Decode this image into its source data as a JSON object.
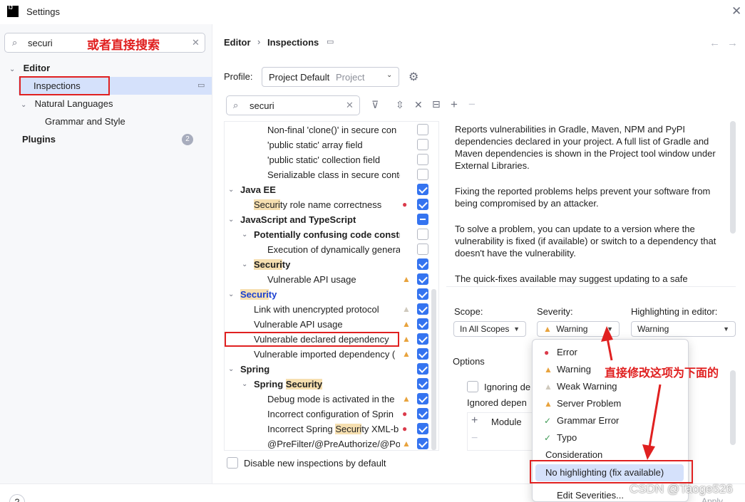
{
  "window": {
    "title": "Settings",
    "app_icon_text": "IJ"
  },
  "left": {
    "search_value": "securi",
    "annotation": "或者直接搜索",
    "tree": [
      {
        "label": "Editor"
      },
      {
        "label": "Inspections"
      },
      {
        "label": "Natural Languages"
      },
      {
        "label": "Grammar and Style"
      },
      {
        "label": "Plugins",
        "badge": "2"
      }
    ]
  },
  "header": {
    "breadcrumb_parent": "Editor",
    "breadcrumb_current": "Inspections",
    "back": "←",
    "forward": "→"
  },
  "profile": {
    "label": "Profile:",
    "value": "Project Default",
    "suffix": "Project"
  },
  "filter": {
    "search_value": "securi"
  },
  "inspections": [
    {
      "text": "Non-final 'clone()' in secure con",
      "checked": "off",
      "indent": 3
    },
    {
      "text": "'public static' array field",
      "checked": "off",
      "indent": 3
    },
    {
      "text": "'public static' collection field",
      "checked": "off",
      "indent": 3
    },
    {
      "text": "Serializable class in secure conte",
      "checked": "off",
      "indent": 3
    },
    {
      "text": "Java EE",
      "checked": "on",
      "indent": 1,
      "group": true
    },
    {
      "pre": "",
      "hl": "Securi",
      "post": "ty role name correctness",
      "checked": "on",
      "indent": 2,
      "sev": "err"
    },
    {
      "text": "JavaScript and TypeScript",
      "checked": "mixed",
      "indent": 1,
      "group": true
    },
    {
      "text": "Potentially confusing code constr",
      "checked": "off",
      "indent": 2,
      "group": true
    },
    {
      "text": "Execution of dynamically genera",
      "checked": "off",
      "indent": 3
    },
    {
      "pre": "",
      "hl": "Securi",
      "post": "ty",
      "checked": "on",
      "indent": 2,
      "group": true
    },
    {
      "text": "Vulnerable API usage",
      "checked": "on",
      "indent": 3,
      "sev": "warn"
    },
    {
      "pre": "",
      "hl": "Securi",
      "post": "ty",
      "checked": "on",
      "indent": 1,
      "group": true,
      "blue": true
    },
    {
      "text": "Link with unencrypted protocol",
      "checked": "on",
      "indent": 2,
      "sev": "faint"
    },
    {
      "text": "Vulnerable API usage",
      "checked": "on",
      "indent": 2,
      "sev": "warn"
    },
    {
      "text": "Vulnerable declared dependency",
      "checked": "on",
      "indent": 2,
      "sev": "warn",
      "boxed": true
    },
    {
      "text": "Vulnerable imported dependency (",
      "checked": "on",
      "indent": 2,
      "sev": "warn"
    },
    {
      "text": "Spring",
      "checked": "on",
      "indent": 1,
      "group": true
    },
    {
      "pre": "Spring ",
      "hl": "Security",
      "post": "",
      "checked": "on",
      "indent": 2,
      "group": true
    },
    {
      "text": "Debug mode is activated in the",
      "checked": "on",
      "indent": 3,
      "sev": "warn"
    },
    {
      "text": "Incorrect configuration of Sprin",
      "checked": "on",
      "indent": 3,
      "sev": "err"
    },
    {
      "pre": "Incorrect Spring ",
      "hl": "Securi",
      "post": "ty XML-b",
      "checked": "on",
      "indent": 3,
      "sev": "err"
    },
    {
      "text": "@PreFilter/@PreAuthorize/@Pos",
      "checked": "on",
      "indent": 3,
      "sev": "warn"
    }
  ],
  "disable_new": "Disable new inspections by default",
  "description": [
    "Reports vulnerabilities in Gradle, Maven, NPM and PyPI dependencies declared in your project. A full list of Gradle and Maven dependencies is shown in the Project tool window under External Libraries.",
    "Fixing the reported problems helps prevent your software from being compromised by an attacker.",
    "To solve a problem, you can update to a version where the vulnerability is fixed (if available) or switch to a dependency that doesn't have the vulnerability.",
    "The quick-fixes available may suggest updating to a safe"
  ],
  "scope": {
    "label": "Scope:",
    "value": "In All Scopes"
  },
  "severity": {
    "label": "Severity:",
    "value": "Warning"
  },
  "highlighting": {
    "label": "Highlighting in editor:",
    "value": "Warning"
  },
  "options": {
    "title": "Options",
    "ignoring": "Ignoring de",
    "ignored": "Ignored depen",
    "column": "Module"
  },
  "popup": [
    {
      "label": "Error",
      "icon": "err"
    },
    {
      "label": "Warning",
      "icon": "warn"
    },
    {
      "label": "Weak Warning",
      "icon": "faint"
    },
    {
      "label": "Server Problem",
      "icon": "warn"
    },
    {
      "label": "Grammar Error",
      "icon": "check"
    },
    {
      "label": "Typo",
      "icon": "check"
    },
    {
      "label": "Consideration",
      "icon": ""
    },
    {
      "label": "No highlighting (fix available)",
      "icon": ""
    },
    {
      "label": "Edit Severities...",
      "icon": ""
    }
  ],
  "annotation_right": "直接修改这项为下面的",
  "watermark": "CSDN @Taoge526",
  "footer": {
    "apply": "Apply",
    "help": "?"
  }
}
